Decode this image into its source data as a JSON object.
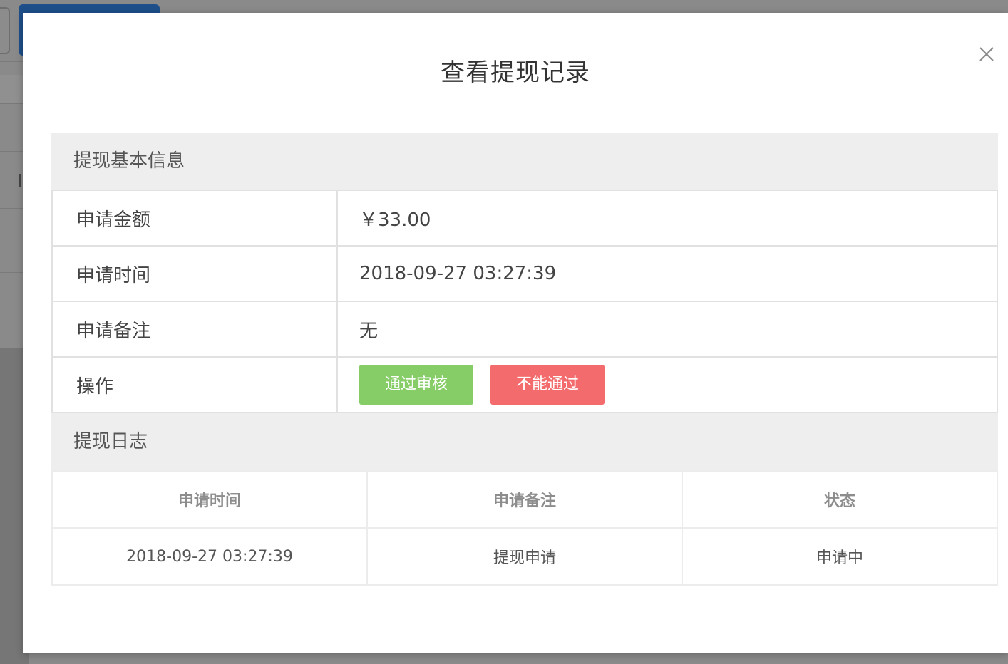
{
  "modal": {
    "title": "查看提现记录"
  },
  "basic_info": {
    "section_title": "提现基本信息",
    "rows": [
      {
        "label": "申请金额",
        "value": "￥33.00"
      },
      {
        "label": "申请时间",
        "value": "2018-09-27 03:27:39"
      },
      {
        "label": "申请备注",
        "value": "无"
      }
    ],
    "action_label": "操作",
    "approve_label": "通过审核",
    "reject_label": "不能通过"
  },
  "log": {
    "section_title": "提现日志",
    "headers": [
      "申请时间",
      "申请备注",
      "状态"
    ],
    "rows": [
      [
        "2018-09-27 03:27:39",
        "提现申请",
        "申请中"
      ]
    ]
  },
  "colors": {
    "approve": "#86cd67",
    "reject": "#f36b6c",
    "section_bg": "#eeeeee"
  },
  "icons": {
    "close": "close-icon"
  }
}
